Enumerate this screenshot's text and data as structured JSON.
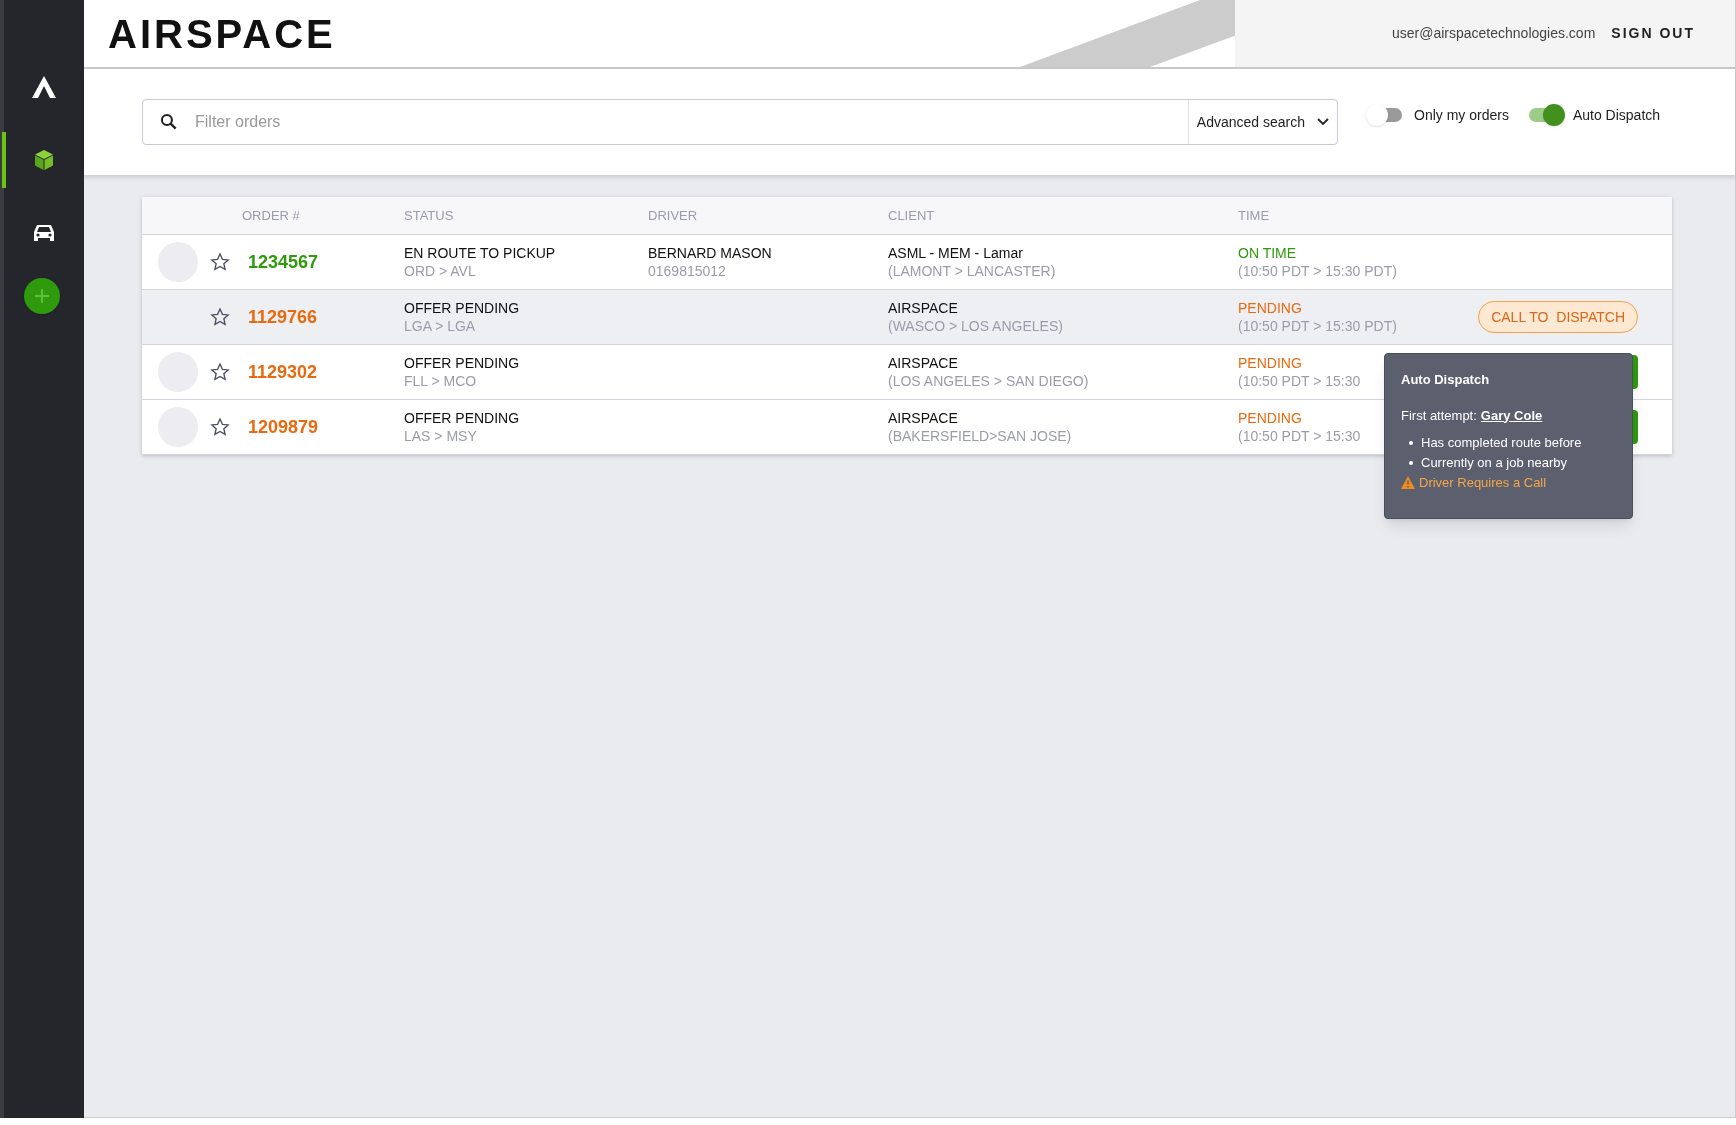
{
  "sidebar": {
    "items": [
      {
        "kind": "logo",
        "selected": false
      },
      {
        "kind": "box",
        "selected": true
      },
      {
        "kind": "car",
        "selected": false
      },
      {
        "kind": "add"
      }
    ]
  },
  "header": {
    "logo": "AIRSPACE",
    "user": "user@airspacetechnologies.com",
    "sign_out": "SIGN OUT"
  },
  "search": {
    "placeholder": "Filter orders",
    "advanced": "Advanced search"
  },
  "toggles": [
    {
      "label": "Only my orders",
      "on": false
    },
    {
      "label": "Auto Dispatch",
      "on": true
    }
  ],
  "table": {
    "columns": [
      "ORDER #",
      "STATUS",
      "DRIVER",
      "CLIENT",
      "TIME"
    ],
    "rows": [
      {
        "avatar": true,
        "selected": false,
        "color": "#2e9a0c",
        "order": "1234567",
        "status": "EN ROUTE TO PICKUP",
        "route": "ORD > AVL",
        "driver": "BERNARD MASON",
        "driver_phone": "0169815012",
        "client": "ASML - MEM - Lamar",
        "client_route": "(LAMONT > LANCASTER)",
        "time_status": "ON TIME",
        "time": "(10:50 PDT > 15:30 PDT)",
        "action": {
          "kind": "none"
        }
      },
      {
        "avatar": false,
        "selected": true,
        "color": "#e8690e",
        "order": "1129766",
        "status": "OFFER PENDING",
        "route": "LGA  > LGA",
        "client": "AIRSPACE",
        "client_route": "(WASCO > LOS ANGELES)",
        "time_status": "PENDING",
        "time": "(10:50 PDT > 15:30 PDT)",
        "action": {
          "kind": "call",
          "label": "CALL TO  DISPATCH"
        }
      },
      {
        "avatar": true,
        "selected": false,
        "color": "#e8690e",
        "order": "1129302",
        "status": "OFFER PENDING",
        "route": "FLL  > MCO",
        "client": "AIRSPACE",
        "client_route": "(LOS ANGELES > SAN DIEGO)",
        "time_status": "PENDING",
        "time": "(10:50 PDT > 15:30",
        "action": {
          "kind": "hidden"
        }
      },
      {
        "avatar": true,
        "selected": false,
        "color": "#e8690e",
        "order": "1209879",
        "status": "OFFER PENDING",
        "route": "LAS  > MSY",
        "client": "AIRSPACE",
        "client_route": "(BAKERSFIELD>SAN JOSE)",
        "time_status": "PENDING",
        "time": "(10:50 PDT > 15:30",
        "action": {
          "kind": "hidden"
        }
      }
    ]
  },
  "tooltip": {
    "title": "Auto Dispatch",
    "first_attempt_label": "First attempt:",
    "first_attempt_driver": "Gary Cole",
    "reasons": [
      "Has completed route before",
      "Currently on a job nearby"
    ],
    "warning": "Driver Requires a Call"
  }
}
